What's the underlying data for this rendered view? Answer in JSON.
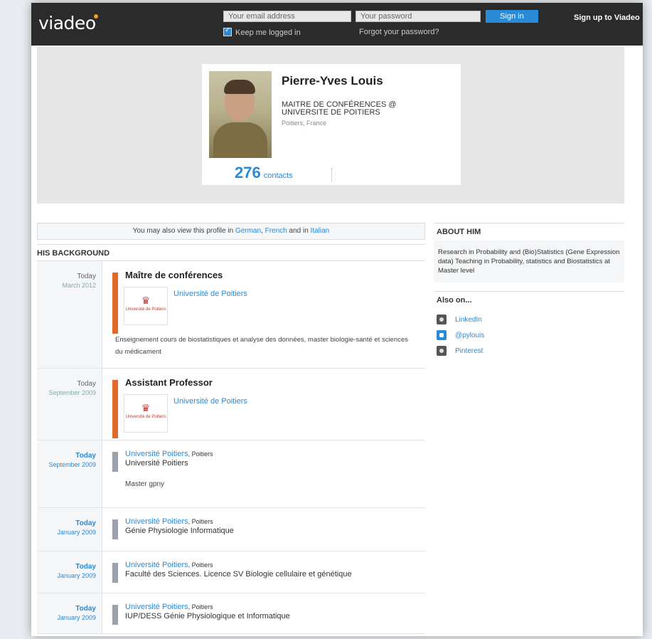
{
  "topbar": {
    "logo": "viadeo",
    "email_placeholder": "Your email address",
    "password_placeholder": "Your password",
    "signin_label": "Sign in",
    "keep_logged_in": "Keep me logged in",
    "forgot_password": "Forgot your password?",
    "signup_label": "Sign up to Viadeo"
  },
  "profile": {
    "name": "Pierre-Yves Louis",
    "headline": "MAITRE DE CONFÉRENCES @ UNIVERSITE DE POITIERS",
    "location": "Poitiers, France",
    "contacts_count": "276",
    "contacts_label": "contacts"
  },
  "languages_notice": {
    "prefix": "You may also view this profile in",
    "lang1": "German",
    "sep1": ",",
    "lang2": "French",
    "and": "and in",
    "lang3": "Italian"
  },
  "background": {
    "title": "HIS BACKGROUND",
    "entries": [
      {
        "today": "Today",
        "period": "March 2012",
        "title": "Maître de conférences",
        "org": "Université de Poitiers",
        "logo_text": "Université de Poitiers",
        "description": "Enseignement cours de biostatistiques et analyse des données, master biologie-santé et sciences du médicament"
      },
      {
        "today": "Today",
        "period": "September 2009",
        "title": "Assistant Professor",
        "org": "Université de Poitiers",
        "logo_text": "Université de Poitiers"
      }
    ],
    "education": [
      {
        "today": "Today",
        "period": "September 2009",
        "school": "Université Poitiers",
        "city": ", Poitiers",
        "degree": "Université Poitiers",
        "extra": "Master gpny"
      },
      {
        "today": "Today",
        "period": "January 2009",
        "school": "Université Poitiers",
        "city": ", Poitiers",
        "degree": "Génie Physiologie Informatique"
      },
      {
        "today": "Today",
        "period": "January 2009",
        "school": "Université Poitiers",
        "city": ", Poitiers",
        "degree": "Faculté des Sciences. Licence SV Biologie cellulaire et génétique"
      },
      {
        "today": "Today",
        "period": "January 2009",
        "school": "Université Poitiers",
        "city": ", Poitiers",
        "degree": "IUP/DESS Génie Physiologique et Informatique"
      }
    ]
  },
  "about": {
    "title": "ABOUT HIM",
    "text": "Research in Probability and (Bio)Statistics (Gene Expression data) Teaching in Probability, statistics and Biostatistics at Master level"
  },
  "also_on": {
    "title": "Also on...",
    "items": [
      "LinkedIn",
      "@pylouis",
      "Pinterest"
    ]
  },
  "colors": {
    "accent": "#2a8ad8",
    "experience_bar": "#e06a2c",
    "education_bar": "#9aa3ad",
    "topbar": "#2b2b2b"
  }
}
